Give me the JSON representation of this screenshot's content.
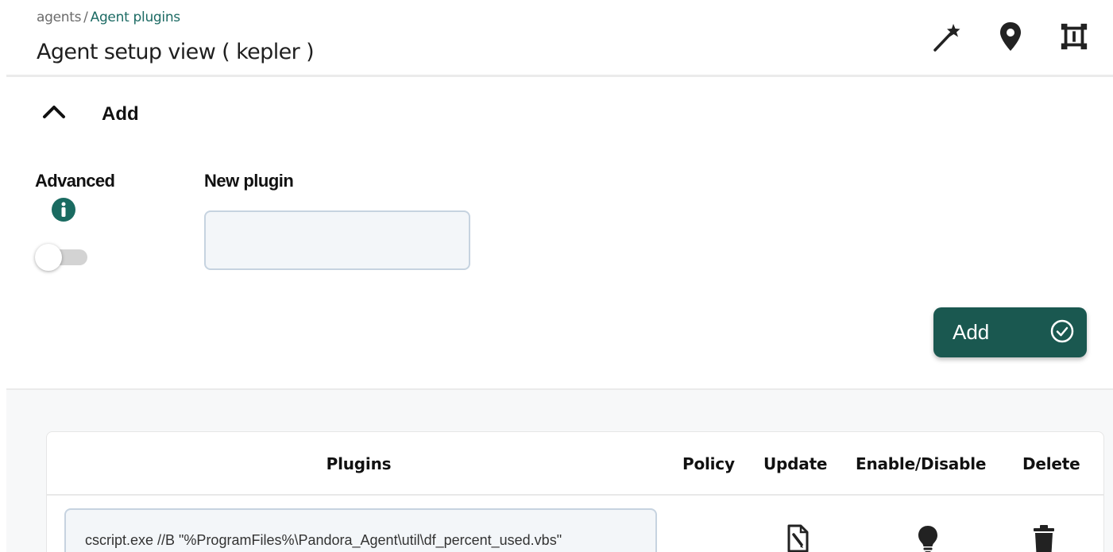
{
  "breadcrumb": {
    "root": "agents",
    "separator": "/",
    "current": "Agent plugins"
  },
  "header": {
    "title": "Agent setup view ( kepler )",
    "icons": [
      "magic-wand-icon",
      "map-pin-icon",
      "fullscreen-icon"
    ]
  },
  "add_section": {
    "title": "Add",
    "advanced_label": "Advanced",
    "advanced_enabled": false,
    "new_plugin_label": "New plugin",
    "new_plugin_value": "",
    "add_button_label": "Add"
  },
  "plugins_table": {
    "columns": {
      "plugins": "Plugins",
      "policy": "Policy",
      "update": "Update",
      "enable_disable": "Enable/Disable",
      "delete": "Delete"
    },
    "rows": [
      {
        "plugin": "cscript.exe //B \"%ProgramFiles%\\Pandora_Agent\\util\\df_percent_used.vbs\"",
        "policy": ""
      }
    ]
  },
  "colors": {
    "accent": "#1a5850",
    "link": "#1d6b64",
    "input_border": "#c6d3e0",
    "input_bg": "#f3f6f9"
  }
}
